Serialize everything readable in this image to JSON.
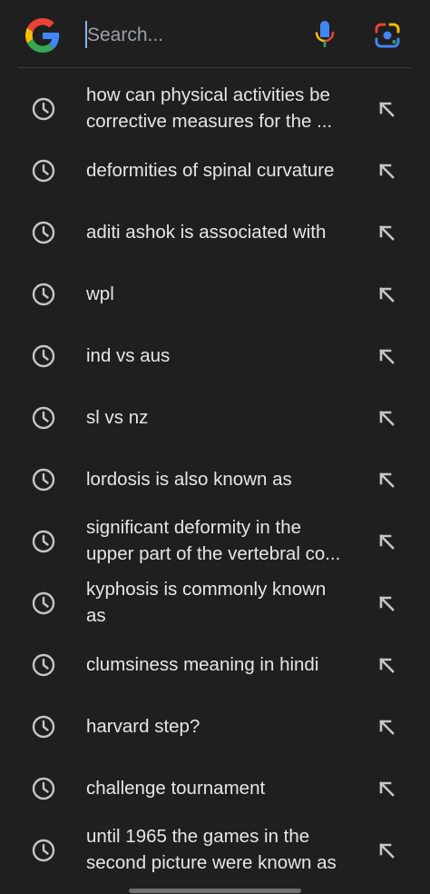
{
  "search": {
    "placeholder": "Search..."
  },
  "history": [
    {
      "line1": "how can physical activities be",
      "line2": "corrective measures for the ..."
    },
    {
      "line1": "deformities of spinal curvature",
      "line2": ""
    },
    {
      "line1": "aditi ashok is associated with",
      "line2": ""
    },
    {
      "line1": "wpl",
      "line2": ""
    },
    {
      "line1": "ind vs aus",
      "line2": ""
    },
    {
      "line1": "sl vs nz",
      "line2": ""
    },
    {
      "line1": "lordosis is also known as",
      "line2": ""
    },
    {
      "line1": "significant deformity in the",
      "line2": "upper part of the vertebral co..."
    },
    {
      "line1": "kyphosis is commonly known",
      "line2": "as"
    },
    {
      "line1": "clumsiness meaning in hindi",
      "line2": ""
    },
    {
      "line1": "harvard step?",
      "line2": ""
    },
    {
      "line1": "challenge tournament",
      "line2": ""
    },
    {
      "line1": "until 1965 the games in the",
      "line2": "second picture were known as"
    }
  ],
  "colors": {
    "background": "#1f1f1f",
    "text": "#e6e6e6",
    "icon": "#c4c7c5",
    "google_blue": "#4285F4",
    "google_red": "#EA4335",
    "google_yellow": "#FBBC05",
    "google_green": "#34A853"
  }
}
